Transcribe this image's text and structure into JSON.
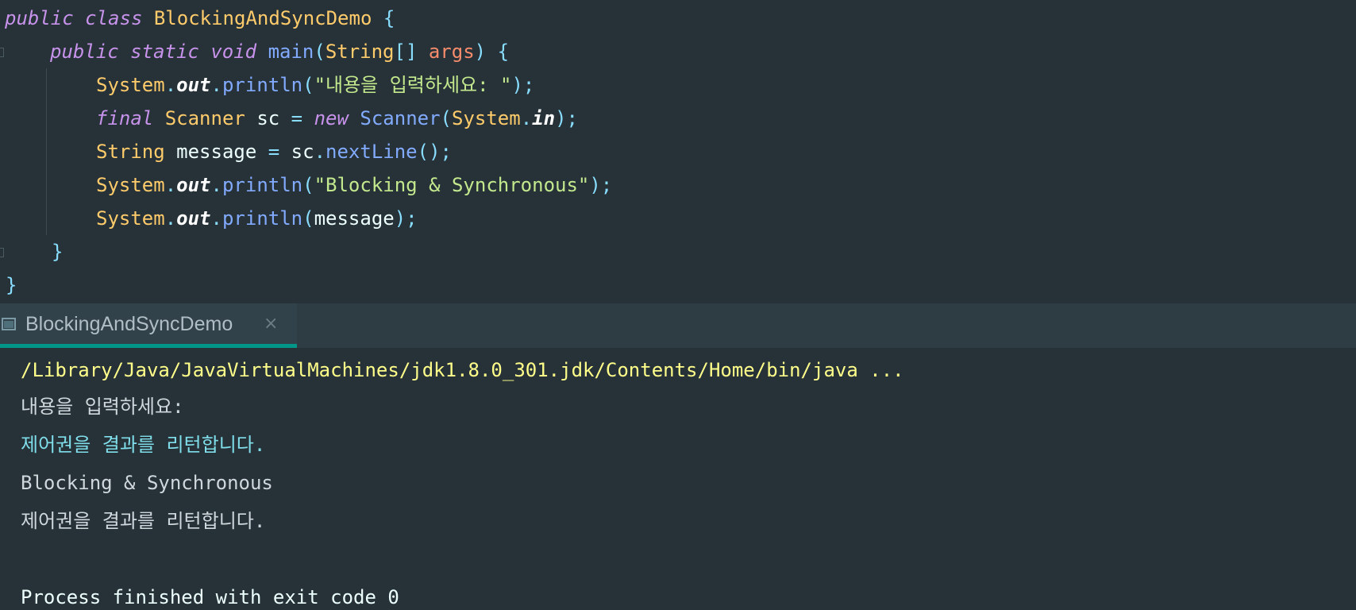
{
  "editor": {
    "lines": [
      {
        "t1": "public",
        "t2": "class",
        "t3": "BlockingAndSyncDemo",
        "t4": "{"
      },
      {
        "t1": "public",
        "t2": "static",
        "t3": "void",
        "t4": "main",
        "t5": "(",
        "t6": "String",
        "t7": "[]",
        "t8": "args",
        "t9": ")",
        "t10": "{"
      },
      {
        "t1": "System",
        "t2": ".",
        "t3": "out",
        "t4": ".",
        "t5": "println",
        "t6": "(",
        "t7": "\"내용을 입력하세요: \"",
        "t8": ");"
      },
      {
        "t1": "final",
        "t2": "Scanner",
        "t3": "sc",
        "t4": "=",
        "t5": "new",
        "t6": "Scanner",
        "t7": "(",
        "t8": "System",
        "t9": ".",
        "t10": "in",
        "t11": ");"
      },
      {
        "t1": "String",
        "t2": "message",
        "t3": "=",
        "t4": "sc",
        "t5": ".",
        "t6": "nextLine",
        "t7": "();"
      },
      {
        "t1": "System",
        "t2": ".",
        "t3": "out",
        "t4": ".",
        "t5": "println",
        "t6": "(",
        "t7": "\"Blocking & Synchronous\"",
        "t8": ");"
      },
      {
        "t1": "System",
        "t2": ".",
        "t3": "out",
        "t4": ".",
        "t5": "println",
        "t6": "(",
        "t7": "message",
        "t8": ");"
      },
      {
        "t1": "}"
      },
      {
        "t1": "}"
      }
    ]
  },
  "run_panel": {
    "tab_label": "BlockingAndSyncDemo",
    "tab_close": "×",
    "icon": "console-icon"
  },
  "console": {
    "command": "/Library/Java/JavaVirtualMachines/jdk1.8.0_301.jdk/Contents/Home/bin/java ...",
    "prompt": "내용을 입력하세요: ",
    "user_input": "제어권을 결과를 리턴합니다.",
    "output1": "Blocking & Synchronous",
    "output2": "제어권을 결과를 리턴합니다.",
    "exit_message": "Process finished with exit code 0"
  },
  "colors": {
    "background": "#263238",
    "keyword": "#c792ea",
    "class": "#ffcb6b",
    "function": "#82aaff",
    "string": "#c3e88d",
    "tab_accent": "#009688",
    "console_command": "#ffff8a",
    "console_input": "#80deea"
  }
}
